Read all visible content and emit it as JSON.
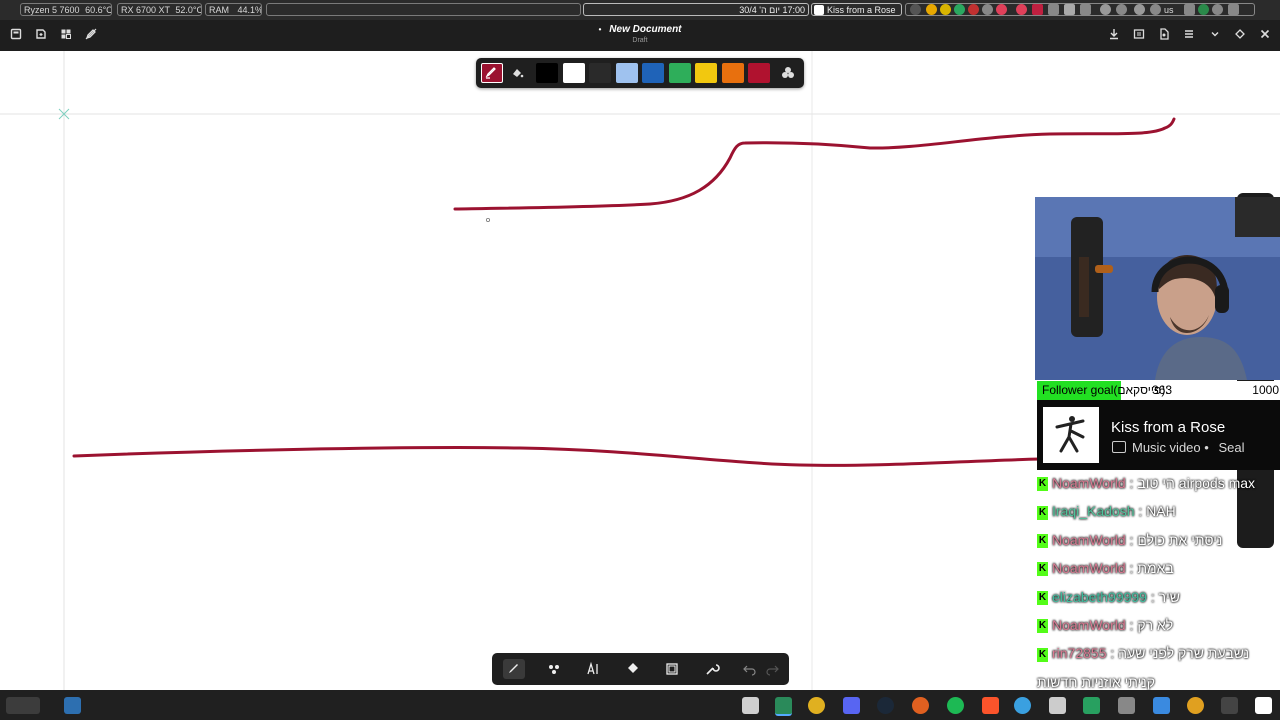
{
  "system_bar": {
    "cpu": "Ryzen 5 7600",
    "cpu_temp": "60.6°C",
    "gpu": "RX 6700 XT",
    "gpu_temp": "52.0°C",
    "ram_label": "RAM",
    "ram_value": "44.1%",
    "clock": "17:00 יום ה' 30/4",
    "active_window": "Kiss from a Rose",
    "keyboard_layout": "us"
  },
  "header": {
    "title": "New Document",
    "subtitle": "Draft",
    "dot": "•"
  },
  "color_palette": [
    "#000000",
    "#ffffff",
    "#2a2a2a",
    "#9fc2ef",
    "#1f63b8",
    "#2eae5a",
    "#f2c80f",
    "#e8700e",
    "#b0122f"
  ],
  "stroke_color": "#9b1230",
  "overlay": {
    "goal_label": "Follower goal(פייסקאם):",
    "goal_current": "363",
    "goal_target": "1000",
    "goal_progress": 0.363,
    "song_title": "Kiss from a Rose",
    "song_type": "Music video",
    "song_artist": "Seal",
    "song_sep": "•"
  },
  "chat": [
    {
      "user": "NoamWorld",
      "text": "הי טוב airpods max",
      "color": "#d97a92"
    },
    {
      "user": "Iraqi_Kadosh",
      "text": "NAH",
      "color": "#4fc29a"
    },
    {
      "user": "NoamWorld",
      "text": "ניסתי את כולם",
      "color": "#d97a92"
    },
    {
      "user": "NoamWorld",
      "text": "באמת",
      "color": "#d97a92"
    },
    {
      "user": "elizabeth99999",
      "text": "שיר",
      "color": "#3fbfa0"
    },
    {
      "user": "NoamWorld",
      "text": "לא רק",
      "color": "#d97a92"
    },
    {
      "user": "rin72855",
      "text": "נשבעת שרק לפני שעה",
      "color": "#d97a92"
    },
    {
      "user": "",
      "text": "קניתי אוזניות חדשות",
      "color": "#d97a92"
    }
  ]
}
